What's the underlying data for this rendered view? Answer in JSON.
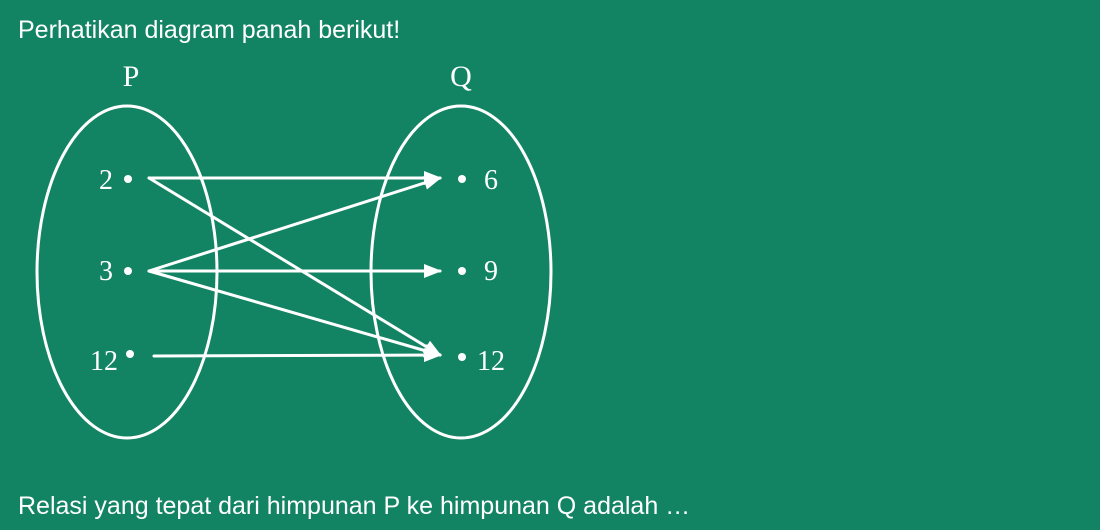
{
  "intro_text": "Perhatikan diagram panah berikut!",
  "question_text": "Relasi yang tepat dari himpunan P ke himpunan Q adalah …",
  "diagram": {
    "domain_label": "P",
    "codomain_label": "Q",
    "domain_elements": [
      "2",
      "3",
      "12"
    ],
    "codomain_elements": [
      "6",
      "9",
      "12"
    ],
    "arrows": [
      {
        "from": "2",
        "to": "6"
      },
      {
        "from": "2",
        "to": "12"
      },
      {
        "from": "3",
        "to": "6"
      },
      {
        "from": "3",
        "to": "9"
      },
      {
        "from": "3",
        "to": "12"
      },
      {
        "from": "12",
        "to": "12"
      }
    ]
  },
  "colors": {
    "background": "#138463",
    "foreground": "#ffffff"
  }
}
